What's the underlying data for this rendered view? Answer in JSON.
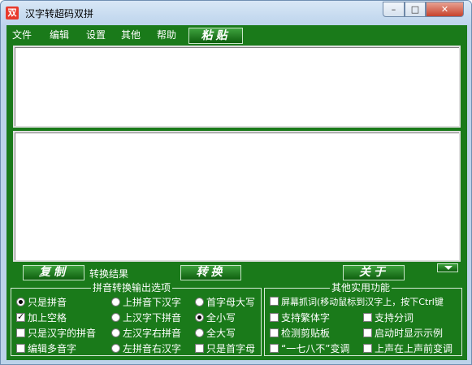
{
  "window": {
    "title": "汉字转超码双拼",
    "icon_char": "双",
    "controls": {
      "minimize": "–",
      "maximize": "□",
      "close": "✕"
    }
  },
  "menu": {
    "items": [
      "文件",
      "编辑",
      "设置",
      "其他",
      "帮助"
    ],
    "paste_button": "粘贴"
  },
  "actions": {
    "copy_button": "复制",
    "result_label": "转换结果",
    "convert_button": "转换",
    "about_button": "关于"
  },
  "pinyin_options": {
    "title": "拼音转换输出选项",
    "col1": [
      {
        "label": "只是拼音",
        "type": "radio",
        "checked": true
      },
      {
        "label": "加上空格",
        "type": "check",
        "checked": true
      },
      {
        "label": "只是汉字的拼音",
        "type": "check",
        "checked": false
      },
      {
        "label": "编辑多音字",
        "type": "check",
        "checked": false
      }
    ],
    "col2": [
      {
        "label": "上拼音下汉字",
        "type": "radio",
        "checked": false
      },
      {
        "label": "上汉字下拼音",
        "type": "radio",
        "checked": false
      },
      {
        "label": "左汉字右拼音",
        "type": "radio",
        "checked": false
      },
      {
        "label": "左拼音右汉字",
        "type": "radio",
        "checked": false
      }
    ],
    "col3": [
      {
        "label": "首字母大写",
        "type": "radio",
        "checked": false
      },
      {
        "label": "全小写",
        "type": "radio",
        "checked": true
      },
      {
        "label": "全大写",
        "type": "radio",
        "checked": false
      },
      {
        "label": "只是首字母",
        "type": "check",
        "checked": false
      }
    ]
  },
  "other_features": {
    "title": "其他实用功能",
    "screen_capture": "屏幕抓词(移动鼠标到汉字上，按下Ctrl键",
    "traditional": "支持繁体字",
    "segmentation": "支持分词",
    "clipboard": "检测剪贴板",
    "startup_example": "启动时显示示例",
    "tone_change": "“一七八不”变调",
    "tone_before": "上声在上声前变调"
  }
}
